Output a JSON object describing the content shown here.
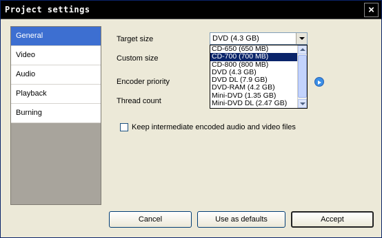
{
  "window": {
    "title": "Project settings",
    "close_label": "×"
  },
  "sidebar": {
    "items": [
      {
        "label": "General",
        "selected": true
      },
      {
        "label": "Video"
      },
      {
        "label": "Audio"
      },
      {
        "label": "Playback"
      },
      {
        "label": "Burning"
      }
    ]
  },
  "general": {
    "target_size_label": "Target size",
    "custom_size_label": "Custom size",
    "encoder_priority_label": "Encoder priority",
    "thread_count_label": "Thread count",
    "target_size_value": "DVD (4.3 GB)",
    "target_size_options": [
      "CD-650 (650 MB)",
      "CD-700 (700 MB)",
      "CD-800 (800 MB)",
      "DVD (4.3 GB)",
      "DVD DL (7.9 GB)",
      "DVD-RAM (4.2 GB)",
      "Mini-DVD (1.35 GB)",
      "Mini-DVD DL (2.47 GB)"
    ],
    "highlighted_option": "CD-700 (700 MB)",
    "keep_files_label": "Keep intermediate encoded audio and video files",
    "keep_files_checked": false
  },
  "buttons": {
    "cancel": "Cancel",
    "defaults": "Use as defaults",
    "accept": "Accept"
  },
  "colors": {
    "selection": "#3d6fd1",
    "title_bar": "#000000",
    "dialog_bg": "#ece9d8"
  }
}
